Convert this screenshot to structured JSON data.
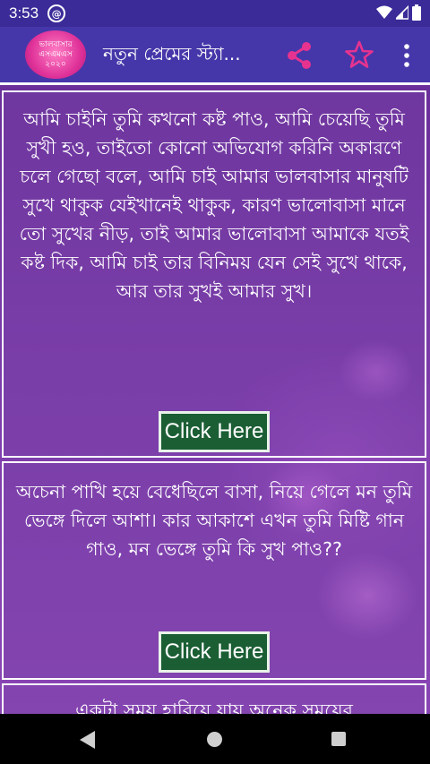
{
  "status": {
    "time": "3:53"
  },
  "app": {
    "logo_lines": [
      "ভালবাসার",
      "এসএমএস",
      "২০২০"
    ],
    "title": "নতুন প্রেমের স্ট্যা..."
  },
  "cards": [
    {
      "text": "আমি চাইনি তুমি কখনো কষ্ট পাও, আমি চেয়েছি তুমি সুখী হও, তাইতো কোনো অভিযোগ করিনি অকারণে চলে গেছো বলে, আমি চাই আমার ভালবাসার মানুষটি সুখে থাকুক যেইখানেই থাকুক, কারণ ভালোবাসা মানে তো সুখের নীড়, তাই আমার ভালোবাসা আমাকে যতই কষ্ট দিক, আমি চাই তার বিনিময় যেন সেই সুখে থাকে, আর তার সুখই আমার সুখ।",
      "button": "Click Here"
    },
    {
      "text": "অচেনা পাখি হয়ে বেধেছিলে বাসা, নিয়ে গেলে মন তুমি ভেঙ্গে দিলে আশা। কার আকাশে এখন তুমি মিষ্টি গান গাও, মন ভেঙ্গে তুমি কি সুখ পাও??",
      "button": "Click Here"
    },
    {
      "text": "একটা সময় হারিয়ে যায় অনেক সময়ের"
    }
  ],
  "colors": {
    "status_bar": "#3a2b99",
    "app_bar": "#4537a9",
    "button": "#1b5e34"
  },
  "icons": {
    "share": "share-icon",
    "star": "star-outline-icon",
    "more": "more-vert-icon"
  }
}
